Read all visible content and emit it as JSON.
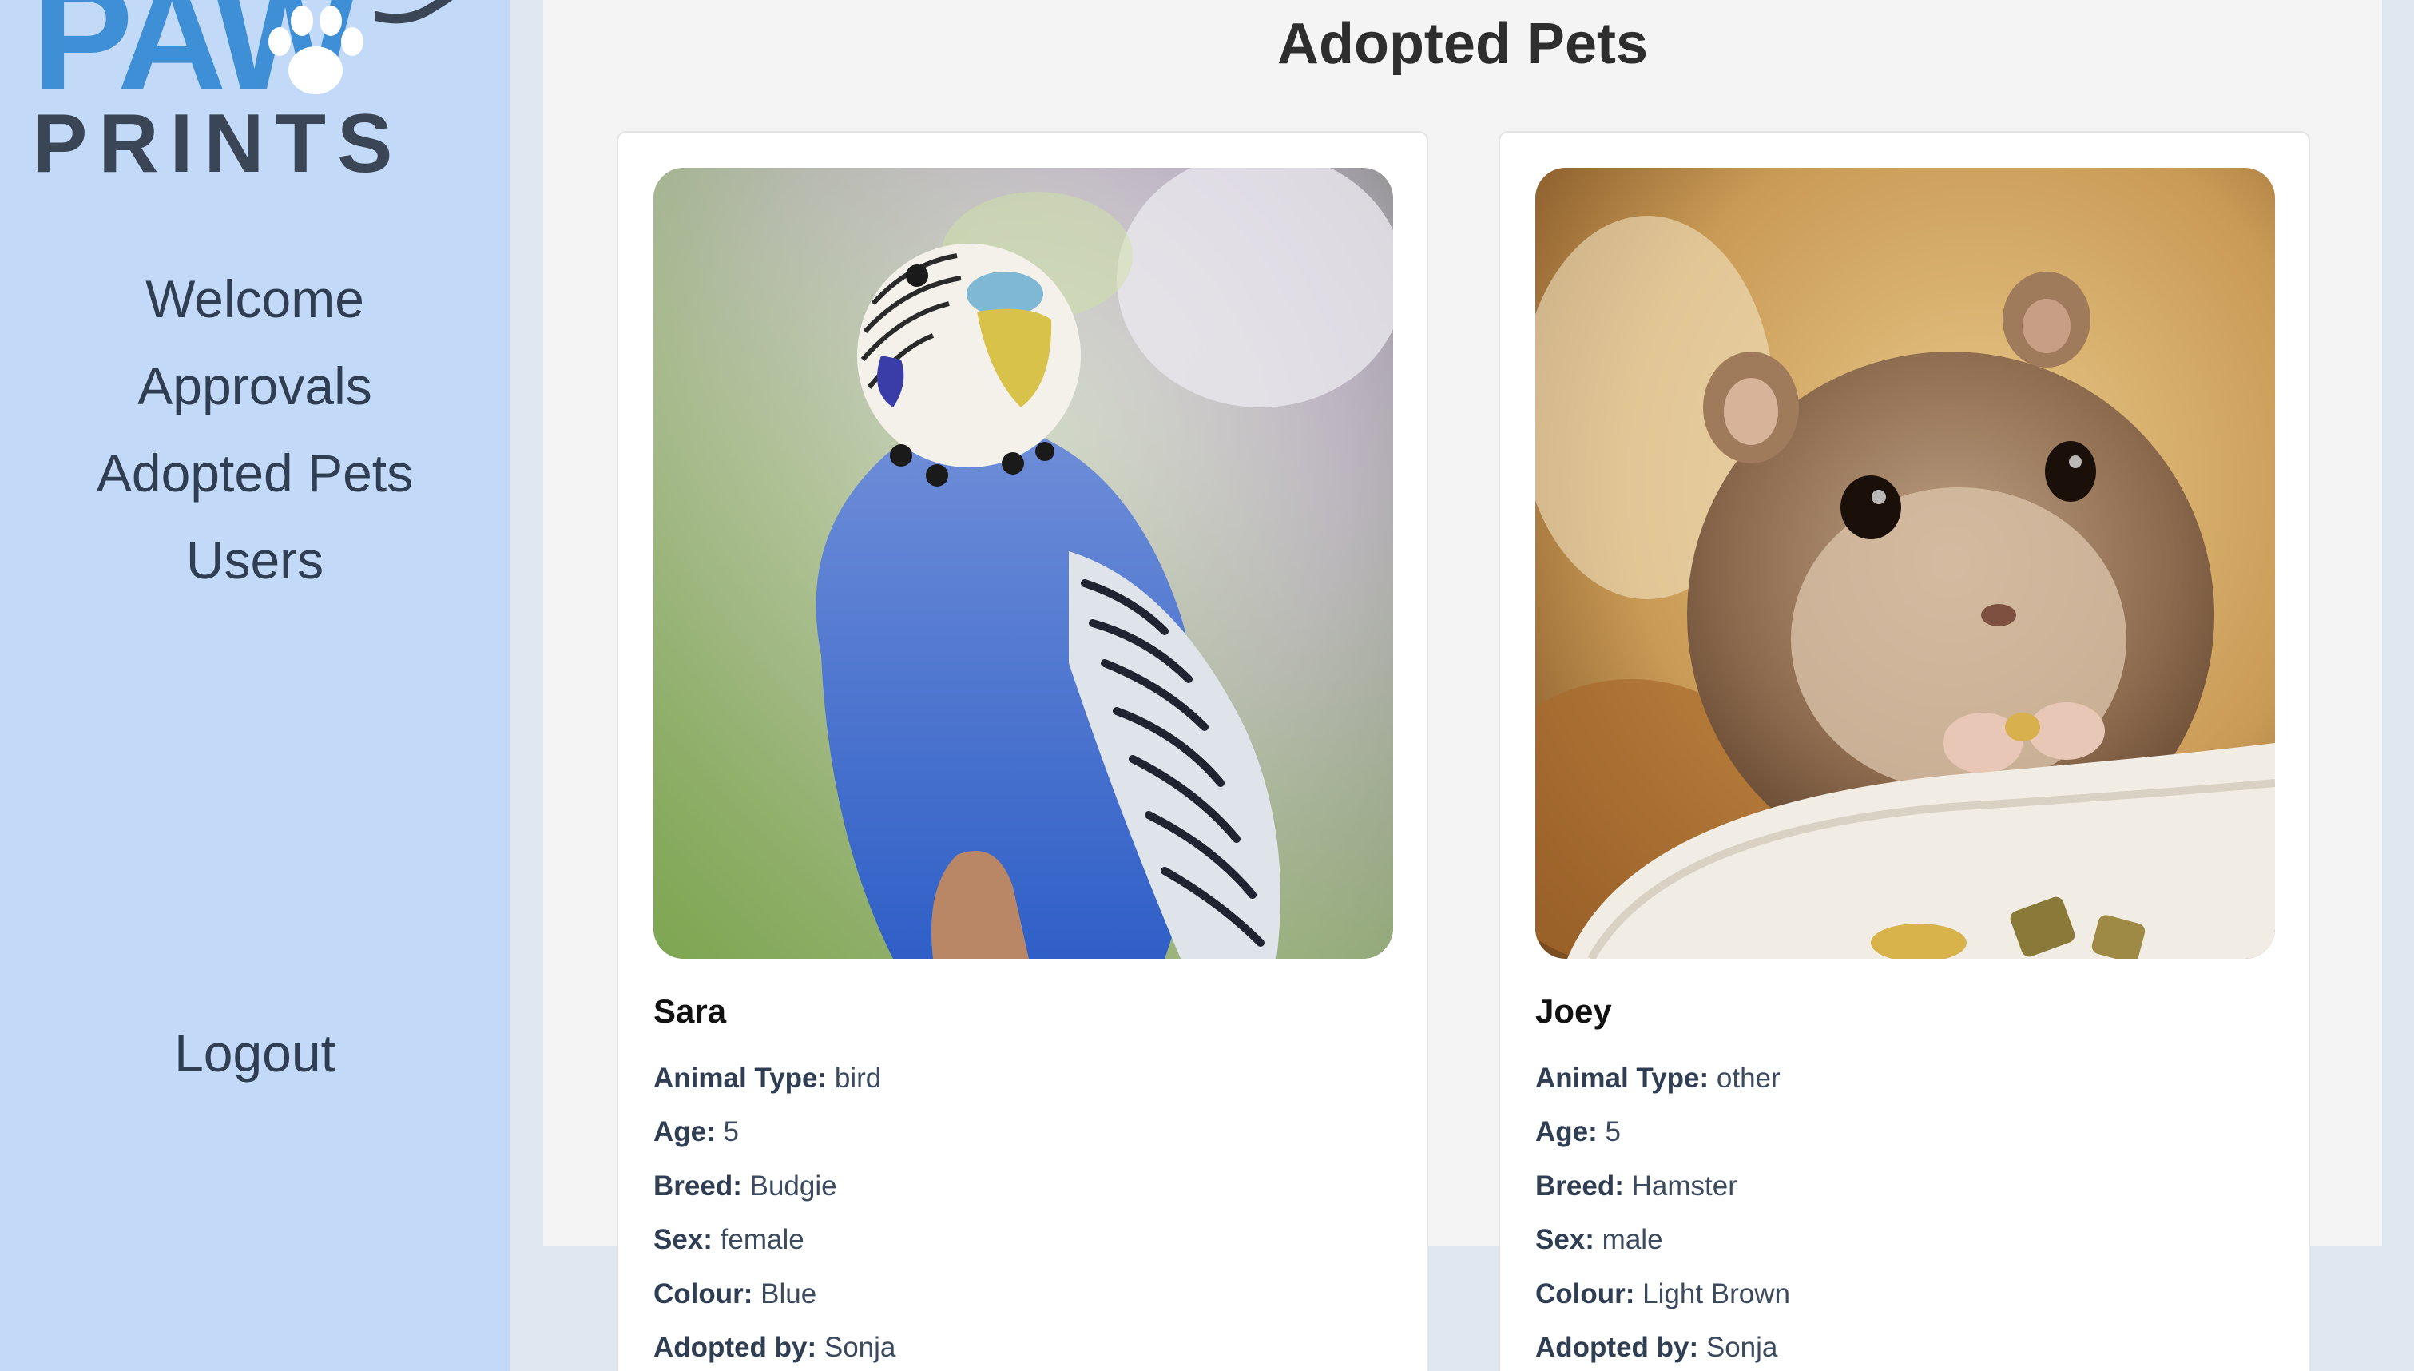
{
  "logo": {
    "word_top": "PAW",
    "word_bottom": "PRINTS",
    "icon": "paw-print-icon"
  },
  "nav": {
    "items": [
      {
        "label": "Welcome"
      },
      {
        "label": "Approvals"
      },
      {
        "label": "Adopted Pets"
      },
      {
        "label": "Users"
      }
    ],
    "logout": "Logout"
  },
  "page": {
    "title": "Adopted Pets"
  },
  "field_labels": {
    "animal_type": "Animal Type:",
    "age": "Age:",
    "breed": "Breed:",
    "sex": "Sex:",
    "colour": "Colour:",
    "adopted_by": "Adopted by:"
  },
  "pets": [
    {
      "name": "Sara",
      "animal_type": "bird",
      "age": "5",
      "breed": "Budgie",
      "sex": "female",
      "colour": "Blue",
      "adopted_by": "Sonja",
      "photo_subject": "budgie-photo"
    },
    {
      "name": "Joey",
      "animal_type": "other",
      "age": "5",
      "breed": "Hamster",
      "sex": "male",
      "colour": "Light Brown",
      "adopted_by": "Sonja",
      "photo_subject": "hamster-photo"
    }
  ],
  "colors": {
    "sidebar_bg": "#c2d9f7",
    "logo_blue": "#3f8fd6",
    "logo_dark": "#3a4655",
    "nav_text": "#2f3e52",
    "main_bg": "#f4f4f4",
    "card_bg": "#ffffff"
  }
}
